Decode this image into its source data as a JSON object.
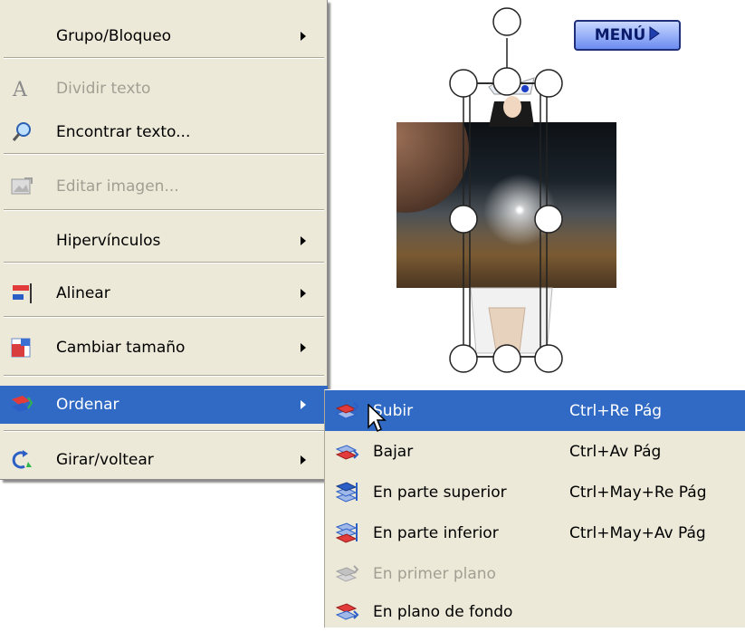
{
  "menu": {
    "items": [
      {
        "label": "Grupo/Bloqueo",
        "icon": "none",
        "submenu": true,
        "disabled": false
      },
      {
        "label": "Dividir texto",
        "icon": "split-text-icon",
        "submenu": false,
        "disabled": true
      },
      {
        "label": "Encontrar texto...",
        "icon": "magnifier-icon",
        "submenu": false,
        "disabled": false
      },
      {
        "label": "Editar imagen...",
        "icon": "edit-image-icon",
        "submenu": false,
        "disabled": true
      },
      {
        "label": "Hipervínculos",
        "icon": "none",
        "submenu": true,
        "disabled": false
      },
      {
        "label": "Alinear",
        "icon": "align-icon",
        "submenu": true,
        "disabled": false
      },
      {
        "label": "Cambiar tamaño",
        "icon": "resize-icon",
        "submenu": true,
        "disabled": false
      },
      {
        "label": "Ordenar",
        "icon": "order-icon",
        "submenu": true,
        "disabled": false,
        "highlighted": true
      },
      {
        "label": "Girar/voltear",
        "icon": "rotate-icon",
        "submenu": true,
        "disabled": false
      }
    ]
  },
  "submenu": {
    "items": [
      {
        "label": "Subir",
        "shortcut": "Ctrl+Re Pág",
        "highlighted": true,
        "disabled": false,
        "icon": "bring-forward-icon"
      },
      {
        "label": "Bajar",
        "shortcut": "Ctrl+Av Pág",
        "highlighted": false,
        "disabled": false,
        "icon": "send-backward-icon"
      },
      {
        "label": "En parte superior",
        "shortcut": "Ctrl+May+Re Pág",
        "highlighted": false,
        "disabled": false,
        "icon": "bring-to-top-icon"
      },
      {
        "label": "En parte inferior",
        "shortcut": "Ctrl+May+Av Pág",
        "highlighted": false,
        "disabled": false,
        "icon": "send-to-bottom-icon"
      },
      {
        "label": "En primer plano",
        "shortcut": "",
        "highlighted": false,
        "disabled": true,
        "icon": "foreground-icon"
      },
      {
        "label": "En plano de fondo",
        "shortcut": "",
        "highlighted": false,
        "disabled": false,
        "icon": "background-icon"
      }
    ]
  },
  "canvas": {
    "menu_badge": "MENÚ"
  },
  "colors": {
    "menu_bg": "#ece9d8",
    "highlight": "#316ac5",
    "disabled_text": "#a19f93",
    "separator": "#aca899"
  }
}
